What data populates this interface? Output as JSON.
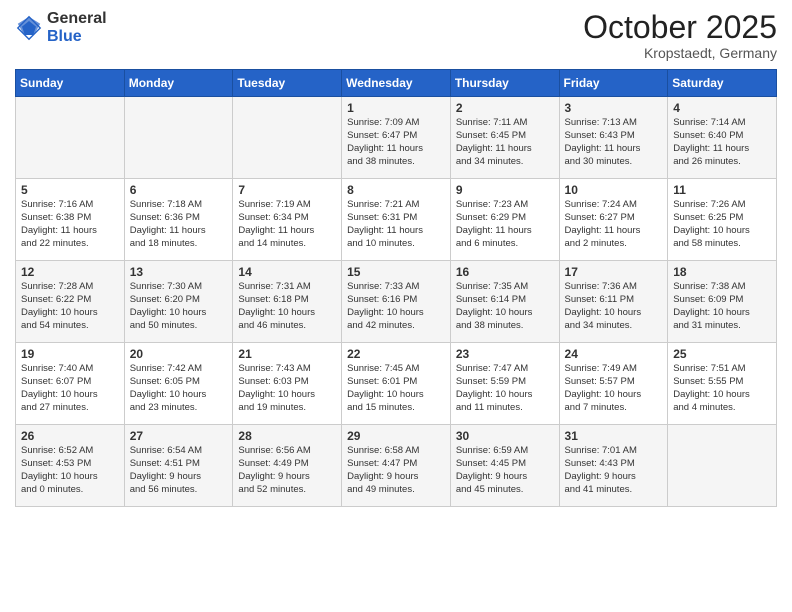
{
  "header": {
    "logo_general": "General",
    "logo_blue": "Blue",
    "month": "October 2025",
    "location": "Kropstaedt, Germany"
  },
  "days_of_week": [
    "Sunday",
    "Monday",
    "Tuesday",
    "Wednesday",
    "Thursday",
    "Friday",
    "Saturday"
  ],
  "weeks": [
    [
      {
        "day": "",
        "info": ""
      },
      {
        "day": "",
        "info": ""
      },
      {
        "day": "",
        "info": ""
      },
      {
        "day": "1",
        "info": "Sunrise: 7:09 AM\nSunset: 6:47 PM\nDaylight: 11 hours\nand 38 minutes."
      },
      {
        "day": "2",
        "info": "Sunrise: 7:11 AM\nSunset: 6:45 PM\nDaylight: 11 hours\nand 34 minutes."
      },
      {
        "day": "3",
        "info": "Sunrise: 7:13 AM\nSunset: 6:43 PM\nDaylight: 11 hours\nand 30 minutes."
      },
      {
        "day": "4",
        "info": "Sunrise: 7:14 AM\nSunset: 6:40 PM\nDaylight: 11 hours\nand 26 minutes."
      }
    ],
    [
      {
        "day": "5",
        "info": "Sunrise: 7:16 AM\nSunset: 6:38 PM\nDaylight: 11 hours\nand 22 minutes."
      },
      {
        "day": "6",
        "info": "Sunrise: 7:18 AM\nSunset: 6:36 PM\nDaylight: 11 hours\nand 18 minutes."
      },
      {
        "day": "7",
        "info": "Sunrise: 7:19 AM\nSunset: 6:34 PM\nDaylight: 11 hours\nand 14 minutes."
      },
      {
        "day": "8",
        "info": "Sunrise: 7:21 AM\nSunset: 6:31 PM\nDaylight: 11 hours\nand 10 minutes."
      },
      {
        "day": "9",
        "info": "Sunrise: 7:23 AM\nSunset: 6:29 PM\nDaylight: 11 hours\nand 6 minutes."
      },
      {
        "day": "10",
        "info": "Sunrise: 7:24 AM\nSunset: 6:27 PM\nDaylight: 11 hours\nand 2 minutes."
      },
      {
        "day": "11",
        "info": "Sunrise: 7:26 AM\nSunset: 6:25 PM\nDaylight: 10 hours\nand 58 minutes."
      }
    ],
    [
      {
        "day": "12",
        "info": "Sunrise: 7:28 AM\nSunset: 6:22 PM\nDaylight: 10 hours\nand 54 minutes."
      },
      {
        "day": "13",
        "info": "Sunrise: 7:30 AM\nSunset: 6:20 PM\nDaylight: 10 hours\nand 50 minutes."
      },
      {
        "day": "14",
        "info": "Sunrise: 7:31 AM\nSunset: 6:18 PM\nDaylight: 10 hours\nand 46 minutes."
      },
      {
        "day": "15",
        "info": "Sunrise: 7:33 AM\nSunset: 6:16 PM\nDaylight: 10 hours\nand 42 minutes."
      },
      {
        "day": "16",
        "info": "Sunrise: 7:35 AM\nSunset: 6:14 PM\nDaylight: 10 hours\nand 38 minutes."
      },
      {
        "day": "17",
        "info": "Sunrise: 7:36 AM\nSunset: 6:11 PM\nDaylight: 10 hours\nand 34 minutes."
      },
      {
        "day": "18",
        "info": "Sunrise: 7:38 AM\nSunset: 6:09 PM\nDaylight: 10 hours\nand 31 minutes."
      }
    ],
    [
      {
        "day": "19",
        "info": "Sunrise: 7:40 AM\nSunset: 6:07 PM\nDaylight: 10 hours\nand 27 minutes."
      },
      {
        "day": "20",
        "info": "Sunrise: 7:42 AM\nSunset: 6:05 PM\nDaylight: 10 hours\nand 23 minutes."
      },
      {
        "day": "21",
        "info": "Sunrise: 7:43 AM\nSunset: 6:03 PM\nDaylight: 10 hours\nand 19 minutes."
      },
      {
        "day": "22",
        "info": "Sunrise: 7:45 AM\nSunset: 6:01 PM\nDaylight: 10 hours\nand 15 minutes."
      },
      {
        "day": "23",
        "info": "Sunrise: 7:47 AM\nSunset: 5:59 PM\nDaylight: 10 hours\nand 11 minutes."
      },
      {
        "day": "24",
        "info": "Sunrise: 7:49 AM\nSunset: 5:57 PM\nDaylight: 10 hours\nand 7 minutes."
      },
      {
        "day": "25",
        "info": "Sunrise: 7:51 AM\nSunset: 5:55 PM\nDaylight: 10 hours\nand 4 minutes."
      }
    ],
    [
      {
        "day": "26",
        "info": "Sunrise: 6:52 AM\nSunset: 4:53 PM\nDaylight: 10 hours\nand 0 minutes."
      },
      {
        "day": "27",
        "info": "Sunrise: 6:54 AM\nSunset: 4:51 PM\nDaylight: 9 hours\nand 56 minutes."
      },
      {
        "day": "28",
        "info": "Sunrise: 6:56 AM\nSunset: 4:49 PM\nDaylight: 9 hours\nand 52 minutes."
      },
      {
        "day": "29",
        "info": "Sunrise: 6:58 AM\nSunset: 4:47 PM\nDaylight: 9 hours\nand 49 minutes."
      },
      {
        "day": "30",
        "info": "Sunrise: 6:59 AM\nSunset: 4:45 PM\nDaylight: 9 hours\nand 45 minutes."
      },
      {
        "day": "31",
        "info": "Sunrise: 7:01 AM\nSunset: 4:43 PM\nDaylight: 9 hours\nand 41 minutes."
      },
      {
        "day": "",
        "info": ""
      }
    ]
  ]
}
